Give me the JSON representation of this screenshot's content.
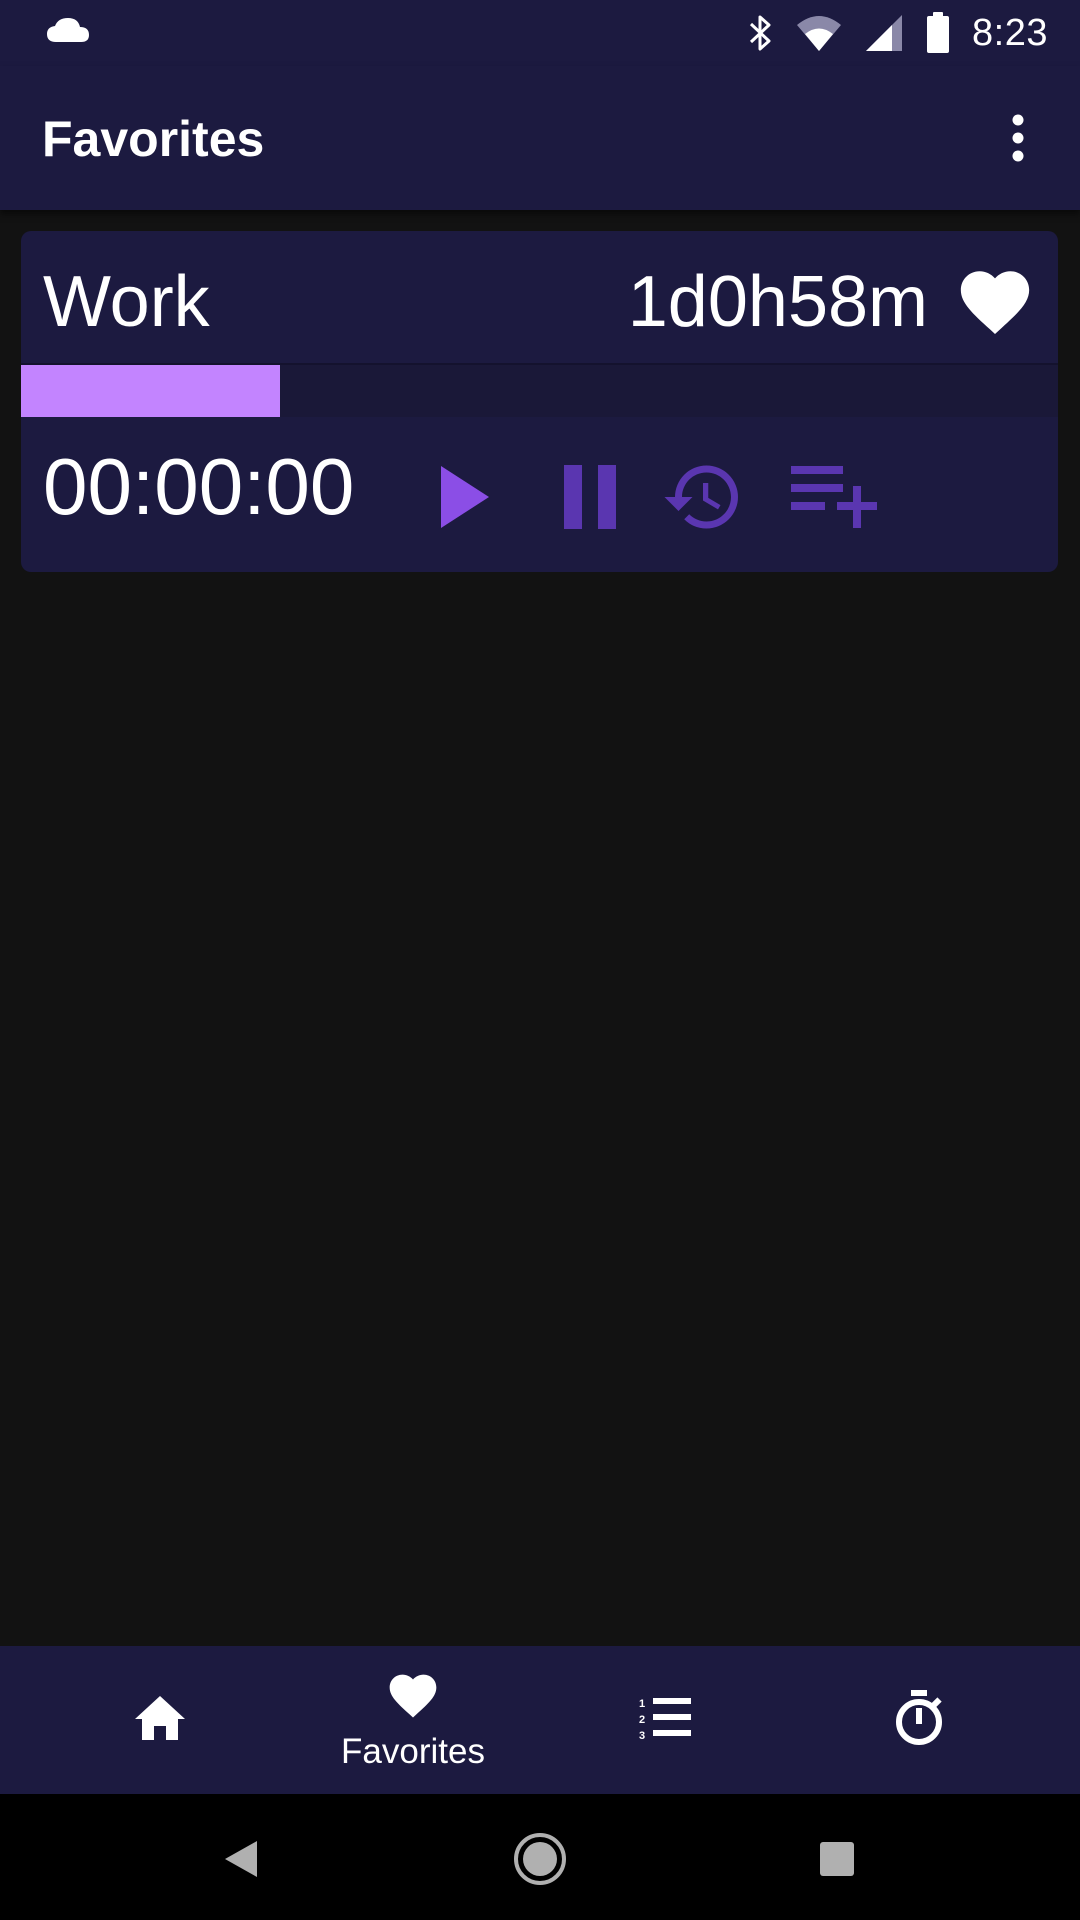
{
  "status_bar": {
    "time": "8:23",
    "icons": [
      "cloud-icon",
      "bluetooth-icon",
      "wifi-icon",
      "signal-icon",
      "battery-icon"
    ]
  },
  "app_bar": {
    "title": "Favorites",
    "menu_icon": "more-vert-icon"
  },
  "card": {
    "title": "Work",
    "total_time": "1d0h58m",
    "favorite_icon": "heart-icon",
    "progress_fraction": 0.25,
    "timer": "00:00:00",
    "controls": [
      "play-icon",
      "pause-icon",
      "history-icon",
      "playlist-add-icon"
    ]
  },
  "bottom_nav": {
    "items": [
      {
        "icon": "home-icon",
        "label": ""
      },
      {
        "icon": "heart-icon",
        "label": "Favorites",
        "selected": true
      },
      {
        "icon": "numbered-list-icon",
        "label": ""
      },
      {
        "icon": "stopwatch-icon",
        "label": ""
      }
    ]
  },
  "system_nav": {
    "buttons": [
      "back-icon",
      "home-circle-icon",
      "recents-icon"
    ]
  },
  "colors": {
    "surface": "#1c1a40",
    "background": "#121212",
    "accent": "#c384ff",
    "play": "#8b4ee6",
    "controls": "#5a36b0",
    "text": "#ffffff"
  }
}
